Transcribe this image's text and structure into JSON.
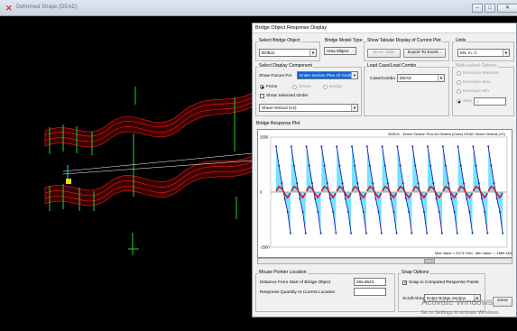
{
  "window": {
    "title": "Deformed Shape (DEAD)",
    "controls": {
      "minimize": "–",
      "maximize": "□",
      "close": "✕"
    }
  },
  "dialog": {
    "title": "Bridge Object Response Display",
    "bridge_object": {
      "label": "Select Bridge Object",
      "value": "BOBJ1"
    },
    "bridge_model_type": {
      "label": "Bridge Model Type",
      "value": "Area Object"
    },
    "tabular": {
      "label": "Show Tabular Display of Current Plot",
      "show_table": "Show Table",
      "export": "Export To Excel..."
    },
    "units": {
      "label": "Units",
      "value": "KN, m, C"
    },
    "display_component": {
      "label": "Select Display Component",
      "show_forces_for_label": "Show Forces For",
      "show_forces_for_value": "Entire Section Plus All Girders",
      "force": "Force",
      "stress": "Stress",
      "design": "Design",
      "show_selected_girder": "Show Selected Girder",
      "component_value": "Shear Vertical (V2)"
    },
    "load_case": {
      "label": "Load Case/Load Combo",
      "case_label": "Case/Combo",
      "value": "DEAD"
    },
    "multivalued": {
      "label": "Multi-valued Options",
      "envelope_max_min": "Envelope Max/Min",
      "envelope_max": "Envelope Max",
      "envelope_min": "Envelope Min",
      "step": "Step",
      "step_value": "1"
    },
    "response_plot": {
      "label": "Bridge Response Plot"
    },
    "mouse_pointer": {
      "label": "Mouse Pointer Location",
      "distance_label": "Distance From Start of Bridge Object",
      "distance_value": "265.8523",
      "response_label": "Response Quantity At Current Location",
      "response_value": ""
    },
    "snap": {
      "label": "Snap Options",
      "checkbox_label": "Snap to Computed Response Points",
      "scroll_label": "Scroll Along",
      "scroll_value": "Entire Bridge Section"
    },
    "done": "Done"
  },
  "chart_data": {
    "type": "line",
    "title": "BOBJ1 - Entire Section Plus All Girders  (Case) DEAD   Shear Vertical (V2)",
    "ylim": [
      -2500,
      2500
    ],
    "y_ticks": [
      "2500",
      "0",
      "-2500"
    ],
    "max_value_label": "Max Value = 2073.7461",
    "min_value_label": "Min Value = -1869.462",
    "spans": 15,
    "series": [
      {
        "values_per_span": [
          2073.7,
          1200,
          400,
          -300,
          -900,
          -1869.5
        ]
      },
      {
        "values_per_span": [
          30,
          180,
          120,
          -60,
          -180,
          -30
        ]
      }
    ],
    "colors": {
      "line": "#1e1eb4",
      "fill": "#00ccff",
      "small": "#e01010"
    }
  },
  "watermark": {
    "title": "Activate Windows",
    "subtitle": "Go to Settings to activate Windows."
  }
}
